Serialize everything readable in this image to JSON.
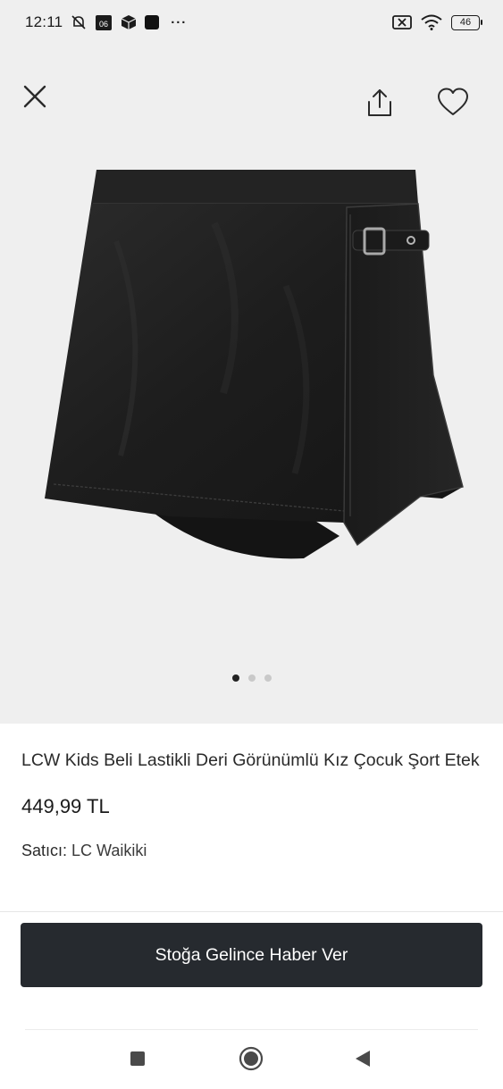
{
  "status_bar": {
    "time": "12:11",
    "notification_badge": "06",
    "more_dots": "···",
    "battery_level": "46"
  },
  "gallery": {
    "image_count": 3,
    "active_index": 0
  },
  "product": {
    "title": "LCW Kids Beli Lastikli Deri Görünümlü Kız Çocuk Şort Etek",
    "price": "449,99 TL",
    "seller_label": "Satıcı:",
    "seller_name": "LC Waikiki"
  },
  "actions": {
    "notify_button": "Stoğa Gelince Haber Ver"
  },
  "colors": {
    "gallery_background": "#efefef",
    "button_background": "#262a2f",
    "button_text": "#ffffff",
    "active_dot": "#222222",
    "inactive_dot": "#c9c9c9"
  },
  "icons": {
    "close": "close-icon",
    "share": "share-icon",
    "favorite": "heart-icon",
    "nav_recents": "square-icon",
    "nav_home": "circle-icon",
    "nav_back": "triangle-back-icon"
  }
}
